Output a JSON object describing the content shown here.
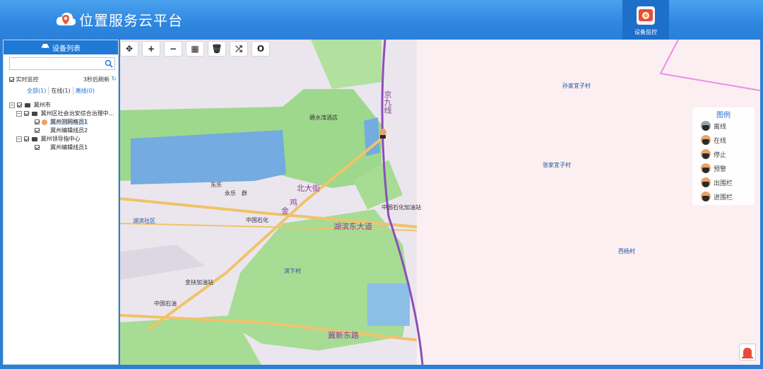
{
  "header": {
    "app_title": "位置服务云平台",
    "monitor_label": "设备监控"
  },
  "left_panel": {
    "title": "设备列表",
    "search": {
      "placeholder": "",
      "value": ""
    },
    "realtime_label": "实时监控",
    "refresh_text": "3秒后刷新",
    "filters": [
      {
        "label": "全部(1)",
        "color": "#1f6fd6"
      },
      {
        "label": "在线(1)",
        "color": "#333333"
      },
      {
        "label": "离线(0)",
        "color": "#1f6fd6"
      }
    ],
    "tree": [
      {
        "label": "冀州市",
        "level": 0
      },
      {
        "label": "冀州区社会治安综合治理中…",
        "level": 1
      },
      {
        "label": "冀州测网格员1",
        "level": 2,
        "selected": true
      },
      {
        "label": "冀州编辑线员2",
        "level": 2
      },
      {
        "label": "冀州领导指中心",
        "level": 1
      },
      {
        "label": "冀州编辑线员1",
        "level": 2
      }
    ]
  },
  "toolbar": {
    "buttons": [
      {
        "name": "move-button",
        "glyph": "✥"
      },
      {
        "name": "zoom-in-button",
        "glyph": "+"
      },
      {
        "name": "zoom-out-button",
        "glyph": "−"
      },
      {
        "name": "grid-button",
        "glyph": "▦"
      },
      {
        "name": "delete-button",
        "glyph": "🗑"
      },
      {
        "name": "shuffle-button",
        "glyph": "⤮"
      },
      {
        "name": "circle-button",
        "glyph": "O"
      }
    ]
  },
  "map": {
    "labels": {
      "sunjia": "孙家宜子村",
      "zhangjia": "张家宜子村",
      "xiyang": "西杨村",
      "bishui": "碧水湾酒店",
      "dongyue": "东乐",
      "yongle": "永乐",
      "yongle2": "群",
      "jinhu": "金",
      "jinhu2": "鸡",
      "beidajie": "北大街",
      "hubin_east": "湖滨东大道",
      "sinopec_station": "中国石化加油站",
      "sinopec": "中国石化",
      "hubin_community": "湖滨社区",
      "xiaxia": "滨下村",
      "jinfu_station": "金扶加油站",
      "sinopec2": "中国石油",
      "jixin_east": "冀新东路",
      "jingjiu_line": "京九线"
    },
    "legend": {
      "title": "图例",
      "items": [
        {
          "label": "离线",
          "color": "#9aa3ad"
        },
        {
          "label": "在线",
          "color": "#e8a36b"
        },
        {
          "label": "停止",
          "color": "#e8a36b"
        },
        {
          "label": "预警",
          "color": "#e8a36b"
        },
        {
          "label": "出围栏",
          "color": "#e8a36b"
        },
        {
          "label": "进围栏",
          "color": "#e8a36b"
        }
      ]
    }
  }
}
